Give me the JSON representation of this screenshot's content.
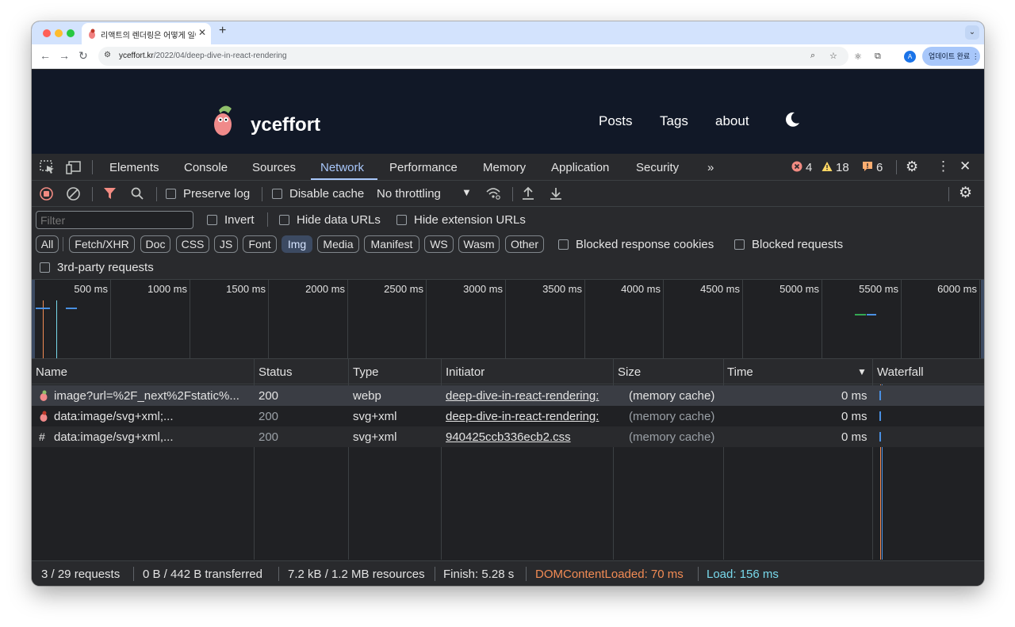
{
  "browser": {
    "tab_title": "리액트의 렌더링은 어떻게 일어나는가",
    "url_domain": "yceffort.kr",
    "url_path": "/2022/04/deep-dive-in-react-rendering",
    "avatar_letter": "A",
    "update_label": "업데이트 완료"
  },
  "site": {
    "name": "yceffort",
    "nav": [
      "Posts",
      "Tags",
      "about"
    ]
  },
  "devtools": {
    "tabs": [
      "Elements",
      "Console",
      "Sources",
      "Network",
      "Performance",
      "Memory",
      "Application",
      "Security"
    ],
    "active_tab": "Network",
    "errors": "4",
    "warnings": "18",
    "issues": "6"
  },
  "network": {
    "toolbar": {
      "preserve_log": "Preserve log",
      "disable_cache": "Disable cache",
      "throttling": "No throttling"
    },
    "filter": {
      "placeholder": "Filter",
      "invert": "Invert",
      "hide_data_urls": "Hide data URLs",
      "hide_extension_urls": "Hide extension URLs",
      "types": [
        "All",
        "Fetch/XHR",
        "Doc",
        "CSS",
        "JS",
        "Font",
        "Img",
        "Media",
        "Manifest",
        "WS",
        "Wasm",
        "Other"
      ],
      "active_type": "Img",
      "blocked_cookies": "Blocked response cookies",
      "blocked_requests": "Blocked requests",
      "third_party": "3rd-party requests"
    },
    "overview_ticks": [
      "500 ms",
      "1000 ms",
      "1500 ms",
      "2000 ms",
      "2500 ms",
      "3000 ms",
      "3500 ms",
      "4000 ms",
      "4500 ms",
      "5000 ms",
      "5500 ms",
      "6000 ms"
    ],
    "columns": [
      "Name",
      "Status",
      "Type",
      "Initiator",
      "Size",
      "Time",
      "Waterfall"
    ],
    "rows": [
      {
        "name": "image?url=%2F_next%2Fstatic%...",
        "status": "200",
        "type": "webp",
        "initiator": "deep-dive-in-react-rendering:",
        "size": "(memory cache)",
        "time": "0 ms"
      },
      {
        "name": "data:image/svg+xml;...",
        "status": "200",
        "type": "svg+xml",
        "initiator": "deep-dive-in-react-rendering:",
        "size": "(memory cache)",
        "time": "0 ms"
      },
      {
        "name": "data:image/svg+xml,...",
        "status": "200",
        "type": "svg+xml",
        "initiator": "940425ccb336ecb2.css",
        "size": "(memory cache)",
        "time": "0 ms"
      }
    ],
    "status_bar": {
      "requests": "3 / 29 requests",
      "transferred": "0 B / 442 B transferred",
      "resources": "7.2 kB / 1.2 MB resources",
      "finish": "Finish: 5.28 s",
      "dom_content_loaded": "DOMContentLoaded: 70 ms",
      "load": "Load: 156 ms"
    }
  },
  "colors": {
    "accent": "#a8c7fa",
    "dom_content_loaded": "#f28b54",
    "load": "#78d9ec",
    "error": "#f28b82",
    "warning": "#fdd663"
  }
}
